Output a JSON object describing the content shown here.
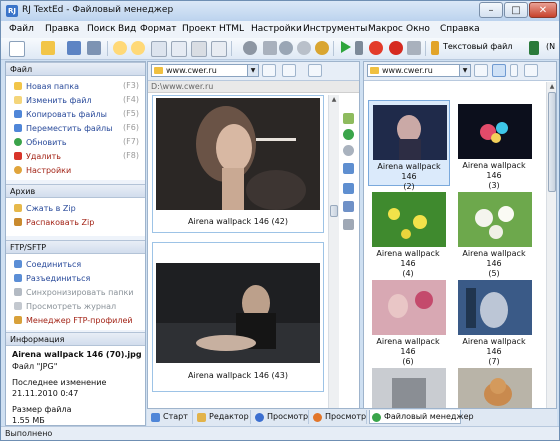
{
  "window": {
    "title": "RJ TextEd - Файловый менеджер",
    "app_icon": "RJ"
  },
  "menu": [
    "Файл",
    "Правка",
    "Поиск",
    "Вид",
    "Формат",
    "Проект",
    "HTML",
    "Настройки",
    "Инструменты",
    "Макрос",
    "Окно",
    "Справка"
  ],
  "toolbar": {
    "text_file_label": "Текстовый файл",
    "cut_label": "(N"
  },
  "left": {
    "file_section": {
      "title": "Файл",
      "items": [
        {
          "label": "Новая папка",
          "shortcut": "(F3)"
        },
        {
          "label": "Изменить файл",
          "shortcut": "(F4)"
        },
        {
          "label": "Копировать файлы",
          "shortcut": "(F5)"
        },
        {
          "label": "Переместить файлы",
          "shortcut": "(F6)"
        },
        {
          "label": "Обновить",
          "shortcut": "(F7)"
        },
        {
          "label": "Удалить",
          "shortcut": "(F8)"
        },
        {
          "label": "Настройки",
          "shortcut": ""
        }
      ]
    },
    "archive_section": {
      "title": "Архив",
      "items": [
        {
          "label": "Сжать в Zip"
        },
        {
          "label": "Распаковать Zip"
        }
      ]
    },
    "ftp_section": {
      "title": "FTP/SFTP",
      "items": [
        {
          "label": "Соединиться"
        },
        {
          "label": "Разъединиться"
        },
        {
          "label": "Синхронизировать папки"
        },
        {
          "label": "Просмотреть журнал"
        },
        {
          "label": "Менеджер FTP-профилей"
        }
      ]
    },
    "info_section": {
      "title": "Информация",
      "filename": "Airena wallpack 146 (70).jpg",
      "filetype": "Файл \"JPG\"",
      "modified_label": "Последнее изменение",
      "modified_value": "21.11.2010 0:47",
      "size_label": "Размер файла",
      "size_value": "1.55 МБ"
    }
  },
  "middle": {
    "path": "www.cwer.ru",
    "breadcrumb": "D:\\www.cwer.ru",
    "previews": [
      {
        "caption": "Airena wallpack 146 (42)"
      },
      {
        "caption": "Airena wallpack 146 (43)"
      }
    ]
  },
  "right": {
    "path": "www.cwer.ru",
    "thumbs": [
      {
        "caption1": "Airena wallpack 146",
        "caption2": "(2)"
      },
      {
        "caption1": "Airena wallpack 146",
        "caption2": "(3)"
      },
      {
        "caption1": "Airena wallpack 146",
        "caption2": "(4)"
      },
      {
        "caption1": "Airena wallpack 146",
        "caption2": "(5)"
      },
      {
        "caption1": "Airena wallpack 146",
        "caption2": "(6)"
      },
      {
        "caption1": "Airena wallpack 146",
        "caption2": "(7)"
      }
    ]
  },
  "tabs": [
    "Старт",
    "Редактор",
    "Просмотр",
    "Просмотр",
    "Файловый менеджер"
  ],
  "status": "Выполнено",
  "colors": {
    "accent": "#3a74c9",
    "link": "#2a4b9b",
    "danger": "#a32417",
    "selection": "#dbeafb"
  }
}
